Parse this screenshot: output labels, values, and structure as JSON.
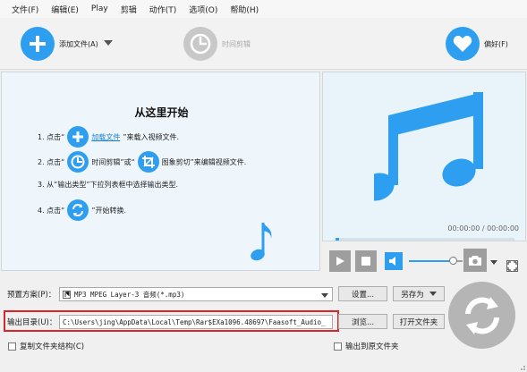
{
  "menu": [
    "文件(F)",
    "编辑(E)",
    "Play",
    "剪辑",
    "动作(T)",
    "选项(O)",
    "帮助(H)"
  ],
  "toolbar": {
    "add_file": "添加文件(A)",
    "time_cut": "时间剪辑",
    "favorites": "偏好(F)"
  },
  "guide": {
    "title": "从这里开始",
    "step1": {
      "num": "1. 点击“",
      "link": "加载文件",
      "rest": "”来载入视频文件."
    },
    "step2": {
      "num": "2. 点击“",
      "mid1": "时间剪辑",
      "mid2": "”或“",
      "mid3": "图象剪切",
      "rest": "”来编辑视频文件."
    },
    "step3": "3. 从“输出类型”下拉列表框中选择输出类型.",
    "step4": {
      "num": "4. 点击“",
      "rest": "”开始转换."
    }
  },
  "player": {
    "time": "00:00:00 / 00:00:00",
    "progress": 0.02,
    "volume": 0.82
  },
  "output": {
    "preset_label": "预置方案(P)：",
    "preset_value": "MP3 MPEG Layer-3 音频(*.mp3)",
    "settings_btn": "设置...",
    "save_as_btn": "另存为",
    "dir_label": "输出目录(U)：",
    "dir_value": "C:\\Users\\jing\\AppData\\Local\\Temp\\Rar$EXa1096.48697\\Faasoft_Audio_",
    "browse_btn": "浏览...",
    "open_folder_btn": "打开文件夹",
    "copy_structure": "复制文件夹结构(C)",
    "output_to_source": "输出到原文件夹"
  },
  "colors": {
    "accent": "#2e9ff0",
    "highlight": "#d8262b"
  }
}
